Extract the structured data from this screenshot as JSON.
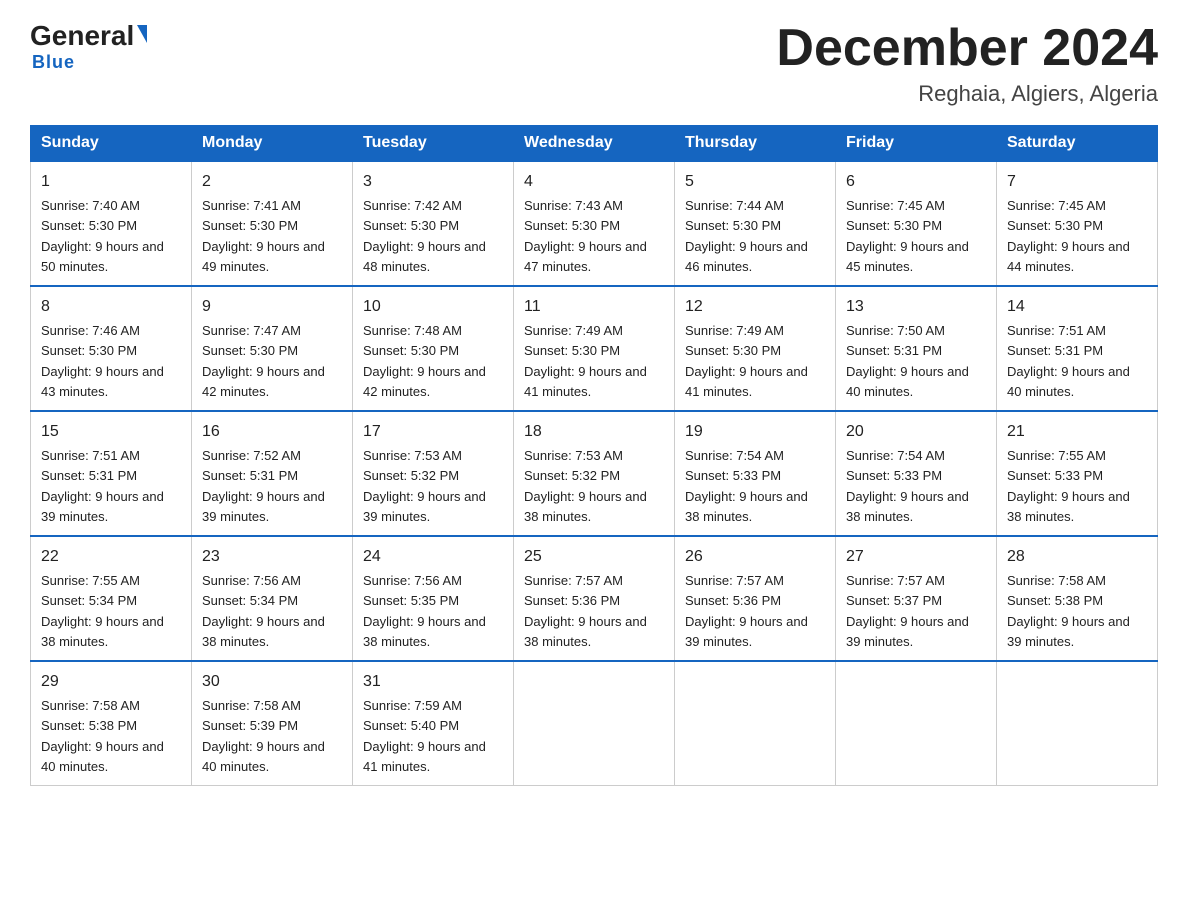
{
  "header": {
    "logo_general": "General",
    "logo_blue": "Blue",
    "main_title": "December 2024",
    "subtitle": "Reghaia, Algiers, Algeria"
  },
  "days_of_week": [
    "Sunday",
    "Monday",
    "Tuesday",
    "Wednesday",
    "Thursday",
    "Friday",
    "Saturday"
  ],
  "weeks": [
    [
      {
        "day": "1",
        "sunrise": "7:40 AM",
        "sunset": "5:30 PM",
        "daylight": "9 hours and 50 minutes."
      },
      {
        "day": "2",
        "sunrise": "7:41 AM",
        "sunset": "5:30 PM",
        "daylight": "9 hours and 49 minutes."
      },
      {
        "day": "3",
        "sunrise": "7:42 AM",
        "sunset": "5:30 PM",
        "daylight": "9 hours and 48 minutes."
      },
      {
        "day": "4",
        "sunrise": "7:43 AM",
        "sunset": "5:30 PM",
        "daylight": "9 hours and 47 minutes."
      },
      {
        "day": "5",
        "sunrise": "7:44 AM",
        "sunset": "5:30 PM",
        "daylight": "9 hours and 46 minutes."
      },
      {
        "day": "6",
        "sunrise": "7:45 AM",
        "sunset": "5:30 PM",
        "daylight": "9 hours and 45 minutes."
      },
      {
        "day": "7",
        "sunrise": "7:45 AM",
        "sunset": "5:30 PM",
        "daylight": "9 hours and 44 minutes."
      }
    ],
    [
      {
        "day": "8",
        "sunrise": "7:46 AM",
        "sunset": "5:30 PM",
        "daylight": "9 hours and 43 minutes."
      },
      {
        "day": "9",
        "sunrise": "7:47 AM",
        "sunset": "5:30 PM",
        "daylight": "9 hours and 42 minutes."
      },
      {
        "day": "10",
        "sunrise": "7:48 AM",
        "sunset": "5:30 PM",
        "daylight": "9 hours and 42 minutes."
      },
      {
        "day": "11",
        "sunrise": "7:49 AM",
        "sunset": "5:30 PM",
        "daylight": "9 hours and 41 minutes."
      },
      {
        "day": "12",
        "sunrise": "7:49 AM",
        "sunset": "5:30 PM",
        "daylight": "9 hours and 41 minutes."
      },
      {
        "day": "13",
        "sunrise": "7:50 AM",
        "sunset": "5:31 PM",
        "daylight": "9 hours and 40 minutes."
      },
      {
        "day": "14",
        "sunrise": "7:51 AM",
        "sunset": "5:31 PM",
        "daylight": "9 hours and 40 minutes."
      }
    ],
    [
      {
        "day": "15",
        "sunrise": "7:51 AM",
        "sunset": "5:31 PM",
        "daylight": "9 hours and 39 minutes."
      },
      {
        "day": "16",
        "sunrise": "7:52 AM",
        "sunset": "5:31 PM",
        "daylight": "9 hours and 39 minutes."
      },
      {
        "day": "17",
        "sunrise": "7:53 AM",
        "sunset": "5:32 PM",
        "daylight": "9 hours and 39 minutes."
      },
      {
        "day": "18",
        "sunrise": "7:53 AM",
        "sunset": "5:32 PM",
        "daylight": "9 hours and 38 minutes."
      },
      {
        "day": "19",
        "sunrise": "7:54 AM",
        "sunset": "5:33 PM",
        "daylight": "9 hours and 38 minutes."
      },
      {
        "day": "20",
        "sunrise": "7:54 AM",
        "sunset": "5:33 PM",
        "daylight": "9 hours and 38 minutes."
      },
      {
        "day": "21",
        "sunrise": "7:55 AM",
        "sunset": "5:33 PM",
        "daylight": "9 hours and 38 minutes."
      }
    ],
    [
      {
        "day": "22",
        "sunrise": "7:55 AM",
        "sunset": "5:34 PM",
        "daylight": "9 hours and 38 minutes."
      },
      {
        "day": "23",
        "sunrise": "7:56 AM",
        "sunset": "5:34 PM",
        "daylight": "9 hours and 38 minutes."
      },
      {
        "day": "24",
        "sunrise": "7:56 AM",
        "sunset": "5:35 PM",
        "daylight": "9 hours and 38 minutes."
      },
      {
        "day": "25",
        "sunrise": "7:57 AM",
        "sunset": "5:36 PM",
        "daylight": "9 hours and 38 minutes."
      },
      {
        "day": "26",
        "sunrise": "7:57 AM",
        "sunset": "5:36 PM",
        "daylight": "9 hours and 39 minutes."
      },
      {
        "day": "27",
        "sunrise": "7:57 AM",
        "sunset": "5:37 PM",
        "daylight": "9 hours and 39 minutes."
      },
      {
        "day": "28",
        "sunrise": "7:58 AM",
        "sunset": "5:38 PM",
        "daylight": "9 hours and 39 minutes."
      }
    ],
    [
      {
        "day": "29",
        "sunrise": "7:58 AM",
        "sunset": "5:38 PM",
        "daylight": "9 hours and 40 minutes."
      },
      {
        "day": "30",
        "sunrise": "7:58 AM",
        "sunset": "5:39 PM",
        "daylight": "9 hours and 40 minutes."
      },
      {
        "day": "31",
        "sunrise": "7:59 AM",
        "sunset": "5:40 PM",
        "daylight": "9 hours and 41 minutes."
      },
      null,
      null,
      null,
      null
    ]
  ]
}
